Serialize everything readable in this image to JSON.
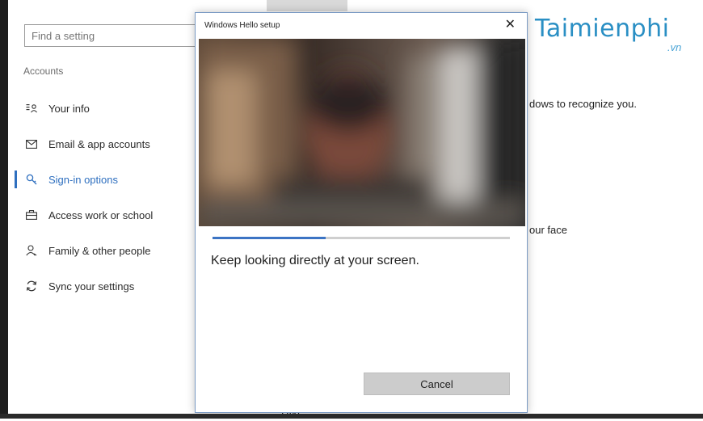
{
  "settings": {
    "search_placeholder": "Find a setting",
    "section_label": "Accounts",
    "nav": [
      {
        "label": "Your info",
        "icon": "person-card-icon"
      },
      {
        "label": "Email & app accounts",
        "icon": "mail-icon"
      },
      {
        "label": "Sign-in options",
        "icon": "key-icon",
        "active": true
      },
      {
        "label": "Access work or school",
        "icon": "briefcase-icon"
      },
      {
        "label": "Family & other people",
        "icon": "people-icon"
      },
      {
        "label": "Sync your settings",
        "icon": "sync-icon"
      }
    ],
    "bg_text_1": "dows to recognize you.",
    "bg_text_2": "our face",
    "bg_text_3": "··· PIN"
  },
  "watermark": {
    "name": "Taimienphi",
    "suffix": ".vn"
  },
  "dialog": {
    "title": "Windows Hello setup",
    "close_glyph": "✕",
    "message": "Keep looking directly at your screen.",
    "progress": 0.38,
    "cancel_label": "Cancel"
  },
  "colors": {
    "accent": "#2e6fbf",
    "progress": "#3c74c4"
  }
}
